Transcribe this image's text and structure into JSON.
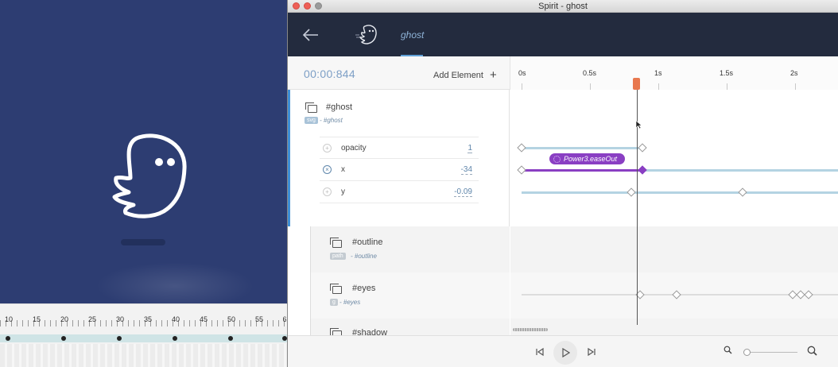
{
  "window": {
    "title": "Spirit - ghost"
  },
  "colors": {
    "header_bg": "#232b3e",
    "accent_blue": "#3f8fd6",
    "ease_purple": "#8a3fc3",
    "playhead_handle": "#e8784f",
    "stage_bg": "#2d3d72"
  },
  "header": {
    "back_icon": "arrow-left-icon",
    "ghost_tab_icon": "ghost-icon",
    "ghost_tab_label": "ghost"
  },
  "toolbar": {
    "time": "00:00:844",
    "add_element_label": "Add Element",
    "add_element_icon": "plus-icon"
  },
  "ruler": {
    "labels": [
      "0s",
      "0.5s",
      "1s",
      "1.5s",
      "2s"
    ]
  },
  "background_ruler": {
    "labels": [
      "10",
      "15",
      "20",
      "25",
      "30",
      "35",
      "40",
      "45",
      "50",
      "55",
      "6"
    ]
  },
  "elements": [
    {
      "title": "#ghost",
      "badge": "svg",
      "subtitle": "- #ghost",
      "props": [
        {
          "name": "opacity",
          "value": "1"
        },
        {
          "name": "x",
          "value": "-34"
        },
        {
          "name": "y",
          "value": "-0.09"
        }
      ]
    },
    {
      "title": "#outline",
      "badge": "path",
      "subtitle": "- #outline"
    },
    {
      "title": "#eyes",
      "badge": "g",
      "subtitle": "- #eyes"
    },
    {
      "title": "#shadow"
    }
  ],
  "timeline": {
    "ease_label": "Power3.easeOut"
  },
  "footer": {
    "prev_icon": "skip-previous-icon",
    "play_icon": "play-icon",
    "next_icon": "skip-next-icon",
    "zoom_out_icon": "zoom-out-icon",
    "zoom_in_icon": "zoom-in-icon"
  }
}
